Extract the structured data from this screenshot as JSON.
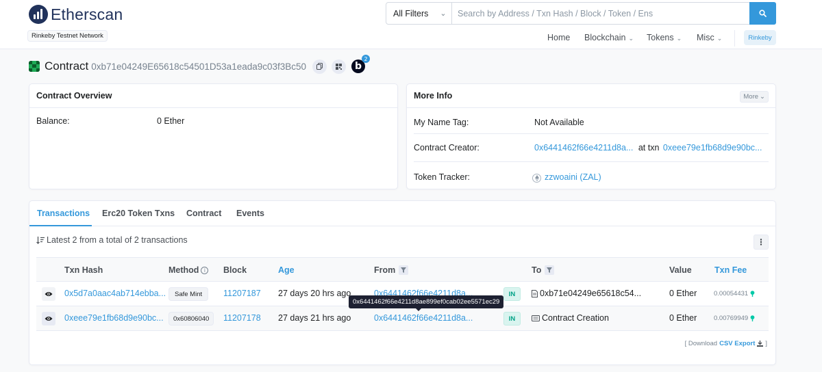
{
  "header": {
    "logo_text": "Etherscan",
    "network_badge": "Rinkeby Testnet Network",
    "search": {
      "filter_selected": "All Filters",
      "placeholder": "Search by Address / Txn Hash / Block / Token / Ens"
    },
    "nav": {
      "home": "Home",
      "blockchain": "Blockchain",
      "tokens": "Tokens",
      "misc": "Misc",
      "network_button": "Rinkeby"
    }
  },
  "title": {
    "label": "Contract",
    "address": "0xb71e04249E65618c54501D53a1eada9c03f3Bc50",
    "blockscan_count": "2"
  },
  "overview": {
    "header": "Contract Overview",
    "balance_label": "Balance:",
    "balance_value": "0 Ether"
  },
  "more_info": {
    "header": "More Info",
    "more_button": "More",
    "name_tag_label": "My Name Tag:",
    "name_tag_value": "Not Available",
    "creator_label": "Contract Creator:",
    "creator_address": "0x6441462f66e4211d8a...",
    "creator_at_txn": "at txn",
    "creator_txn": "0xeee79e1fb68d9e90bc...",
    "token_tracker_label": "Token Tracker:",
    "token_tracker_value": "zzwoaini (ZAL)"
  },
  "tabs": {
    "transactions": "Transactions",
    "erc20": "Erc20 Token Txns",
    "contract": "Contract",
    "events": "Events"
  },
  "transactions": {
    "summary": "Latest 2 from a total of 2 transactions",
    "columns": {
      "hash": "Txn Hash",
      "method": "Method",
      "block": "Block",
      "age": "Age",
      "from": "From",
      "to": "To",
      "value": "Value",
      "fee": "Txn Fee"
    },
    "rows": [
      {
        "hash": "0x5d7a0aac4ab714ebba...",
        "method": "Safe Mint",
        "block": "11207187",
        "age": "27 days 20 hrs ago",
        "from": "0x6441462f66e4211d8a...",
        "direction": "IN",
        "to": "0xb71e04249e65618c54...",
        "value": "0 Ether",
        "fee": "0.00054431"
      },
      {
        "hash": "0xeee79e1fb68d9e90bc...",
        "method": "0x60806040",
        "block": "11207178",
        "age": "27 days 21 hrs ago",
        "from": "0x6441462f66e4211d8a...",
        "direction": "IN",
        "to": "Contract Creation",
        "value": "0 Ether",
        "fee": "0.00769949"
      }
    ],
    "tooltip": "0x6441462f66e4211d8ae899ef0cab02ee5571ec29",
    "csv_prefix": "[ Download",
    "csv_link": "CSV Export",
    "csv_suffix": "]"
  },
  "colors": {
    "accent": "#3498db",
    "brand": "#21325b",
    "in_badge": "#00a186"
  }
}
